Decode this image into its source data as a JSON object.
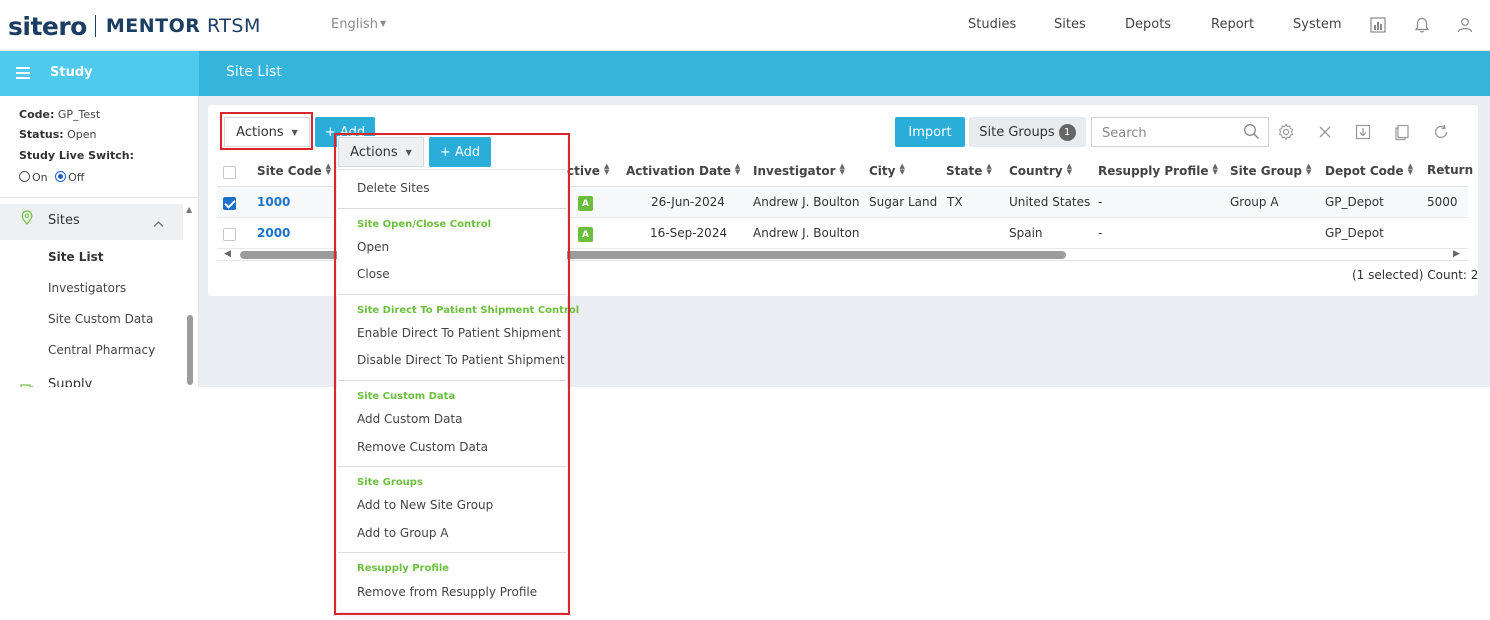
{
  "brand": {
    "name": "sitero",
    "product_bold": "MENTOR",
    "product_rest": "RTSM"
  },
  "language": "English",
  "topnav": [
    "Studies",
    "Sites",
    "Depots",
    "Report",
    "System"
  ],
  "icons": {
    "reports": "chart-icon",
    "notifications": "bell-icon",
    "user": "user-icon"
  },
  "band": {
    "sidebar_title": "Study",
    "page_title": "Site List"
  },
  "study": {
    "code_label": "Code:",
    "code_value": "GP_Test",
    "status_label": "Status:",
    "status_value": "Open",
    "switch_label": "Study Live Switch:",
    "on_label": "On",
    "off_label": "Off"
  },
  "sidebar": {
    "section": "Sites",
    "items": [
      "Site List",
      "Investigators",
      "Site Custom Data",
      "Central Pharmacy"
    ],
    "next_section": "Supply"
  },
  "toolbar": {
    "actions_label": "Actions",
    "add_label": "+ Add",
    "import_label": "Import",
    "site_groups_label": "Site Groups",
    "site_groups_count": "1",
    "search_placeholder": "Search"
  },
  "table": {
    "columns": [
      "Site Code",
      "ctive",
      "Activation Date",
      "Investigator",
      "City",
      "State",
      "Country",
      "Resupply Profile",
      "Site Group",
      "Depot Code",
      "Return"
    ],
    "rows": [
      {
        "site_code": "1000",
        "active": "A",
        "activation_date": "26-Jun-2024",
        "investigator": "Andrew J. Boulton",
        "city": "Sugar Land",
        "state": "TX",
        "country": "United States",
        "resupply": "-",
        "site_group": "Group A",
        "depot": "GP_Depot",
        "return": "5000",
        "checked": true
      },
      {
        "site_code": "2000",
        "active": "A",
        "activation_date": "16-Sep-2024",
        "investigator": "Andrew J. Boulton",
        "city": "",
        "state": "",
        "country": "Spain",
        "resupply": "-",
        "site_group": "",
        "depot": "GP_Depot",
        "return": "",
        "checked": false
      }
    ],
    "count_text": "(1 selected) Count: 2"
  },
  "dropdown": {
    "actions_label": "Actions",
    "add_label": "+ Add",
    "delete": "Delete Sites",
    "group1": "Site Open/Close Control",
    "open": "Open",
    "close": "Close",
    "group2": "Site Direct To Patient Shipment Control",
    "enable_dtp": "Enable Direct To Patient Shipment",
    "disable_dtp": "Disable Direct To Patient Shipment",
    "group3": "Site Custom Data",
    "add_custom": "Add Custom Data",
    "remove_custom": "Remove Custom Data",
    "group4": "Site Groups",
    "add_new_group": "Add to New Site Group",
    "add_group_a": "Add to Group A",
    "group5": "Resupply Profile",
    "remove_resupply": "Remove from Resupply Profile"
  },
  "colors": {
    "accent": "#2aaed9",
    "band": "#36b5dc",
    "band_light": "#4fc9ec",
    "green": "#6cbf3e",
    "highlight": "#d9262a",
    "link": "#1a73c9"
  }
}
